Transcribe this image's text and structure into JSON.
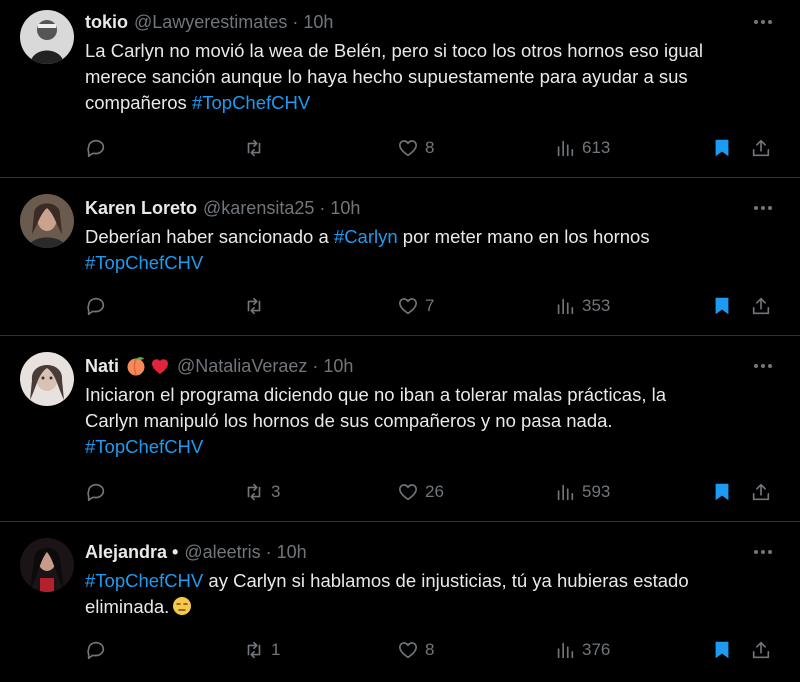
{
  "colors": {
    "background": "#000000",
    "text": "#e7e9ea",
    "muted": "#71767b",
    "link": "#1d9bf0",
    "bookmark": "#1d9bf0",
    "divider": "#2f3336"
  },
  "tweets": [
    {
      "name": "tokio",
      "handle": "@Lawyerestimates",
      "sep": "·",
      "time": "10h",
      "lines": [
        {
          "text": "La Carlyn no movió la wea de Belén, pero si toco los otros hornos eso igual"
        },
        {
          "text": "merece sanción aunque lo haya hecho supuestamente para ayudar a sus"
        },
        {
          "text": "compañeros ",
          "hashtag": "#TopChefCHV"
        }
      ],
      "replies": "",
      "retweets": "",
      "likes": "8",
      "views": "613"
    },
    {
      "name": "Karen Loreto",
      "handle": "@karensita25",
      "sep": "·",
      "time": "10h",
      "lines": [
        {
          "text": "Deberían haber sancionado a ",
          "hashtag": "#Carlyn",
          "after": " por meter mano en los hornos"
        },
        {
          "text": "",
          "hashtag": "#TopChefCHV"
        }
      ],
      "replies": "",
      "retweets": "",
      "likes": "7",
      "views": "353"
    },
    {
      "name": "Nati",
      "name_emojis": [
        "peach-emoji",
        "red-heart-emoji"
      ],
      "handle": "@NataliaVeraez",
      "sep": "·",
      "time": "10h",
      "lines": [
        {
          "text": "Iniciaron el programa diciendo que no iban a tolerar malas prácticas, la"
        },
        {
          "text": "Carlyn manipuló los hornos de sus compañeros y no pasa nada."
        },
        {
          "text": "",
          "hashtag": "#TopChefCHV"
        }
      ],
      "replies": "",
      "retweets": "3",
      "likes": "26",
      "views": "593"
    },
    {
      "name": "Alejandra",
      "name_suffix": "•",
      "handle": "@aleetris",
      "sep": "·",
      "time": "10h",
      "lines": [
        {
          "text": "",
          "hashtag": "#TopChefCHV",
          "after": " ay Carlyn si hablamos de injusticias, tú ya hubieras estado"
        },
        {
          "text": "eliminada.",
          "emoji": "unamused-face-emoji"
        }
      ],
      "replies": "",
      "retweets": "1",
      "likes": "8",
      "views": "376"
    }
  ]
}
